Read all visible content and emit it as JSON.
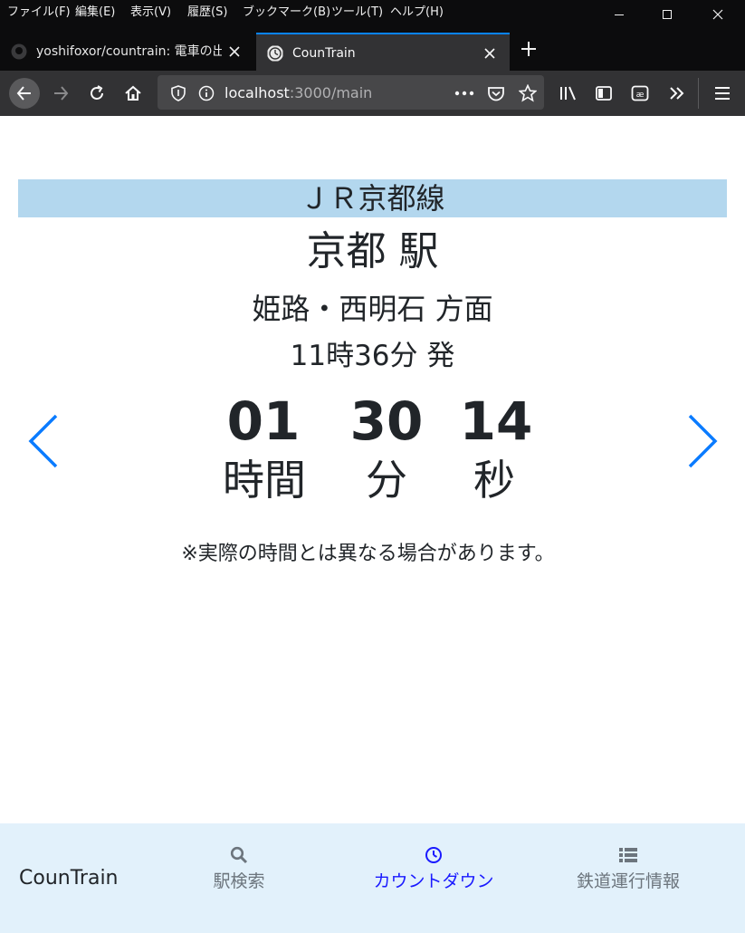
{
  "browser": {
    "menu": [
      "ファイル(F)",
      "編集(E)",
      "表示(V)",
      "履歴(S)",
      "ブックマーク(B)",
      "ツール(T)",
      "ヘルプ(H)"
    ],
    "tabs": [
      {
        "title": "yoshifoxor/countrain: 電車の出発"
      },
      {
        "title": "CounTrain"
      }
    ],
    "url": {
      "host": "localhost",
      "rest": ":3000/main"
    }
  },
  "train": {
    "line": "ＪＲ京都線",
    "station": "京都 駅",
    "direction": "姫路・西明石 方面",
    "departure": "11時36分 発"
  },
  "countdown": {
    "hours": "01",
    "minutes": "30",
    "seconds": "14",
    "hours_label": "時間",
    "minutes_label": "分",
    "seconds_label": "秒"
  },
  "note": "※実際の時間とは異なる場合があります。",
  "footer": {
    "brand": "CounTrain",
    "nav": [
      {
        "label": "駅検索",
        "icon": "search-icon",
        "color": "#6c757d"
      },
      {
        "label": "カウントダウン",
        "icon": "clock-icon",
        "color": "#1a1aff"
      },
      {
        "label": "鉄道運行情報",
        "icon": "list-icon",
        "color": "#6c757d"
      }
    ]
  },
  "colors": {
    "accent": "#0a84ff",
    "banner": "#b3d7ee",
    "footer_bg": "#e2f1fb",
    "active_nav": "#1a1aff"
  }
}
